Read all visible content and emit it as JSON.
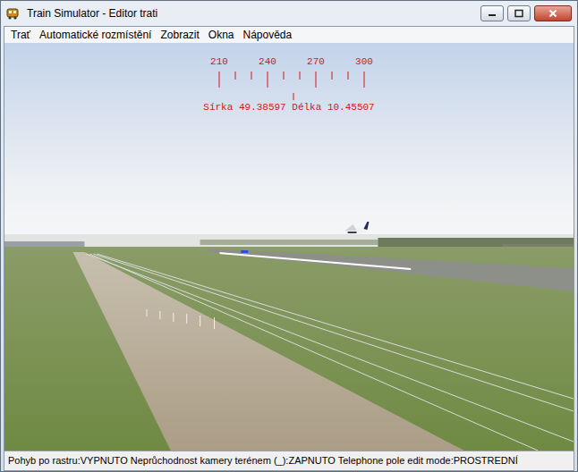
{
  "window": {
    "title": "Train Simulator - Editor trati"
  },
  "menu": [
    "Trať",
    "Automatické rozmístění",
    "Zobrazit",
    "Okna",
    "Nápověda"
  ],
  "compass": {
    "labels": [
      "210",
      "240",
      "270",
      "300"
    ],
    "position": "Sírka 49.38597 Délka 10.45507"
  },
  "status_bar": "Pohyb po rastru:VYPNUTO Neprůchodnost kamery terénem (_):ZAPNUTO Telephone pole edit mode:PROSTREDNÍ"
}
